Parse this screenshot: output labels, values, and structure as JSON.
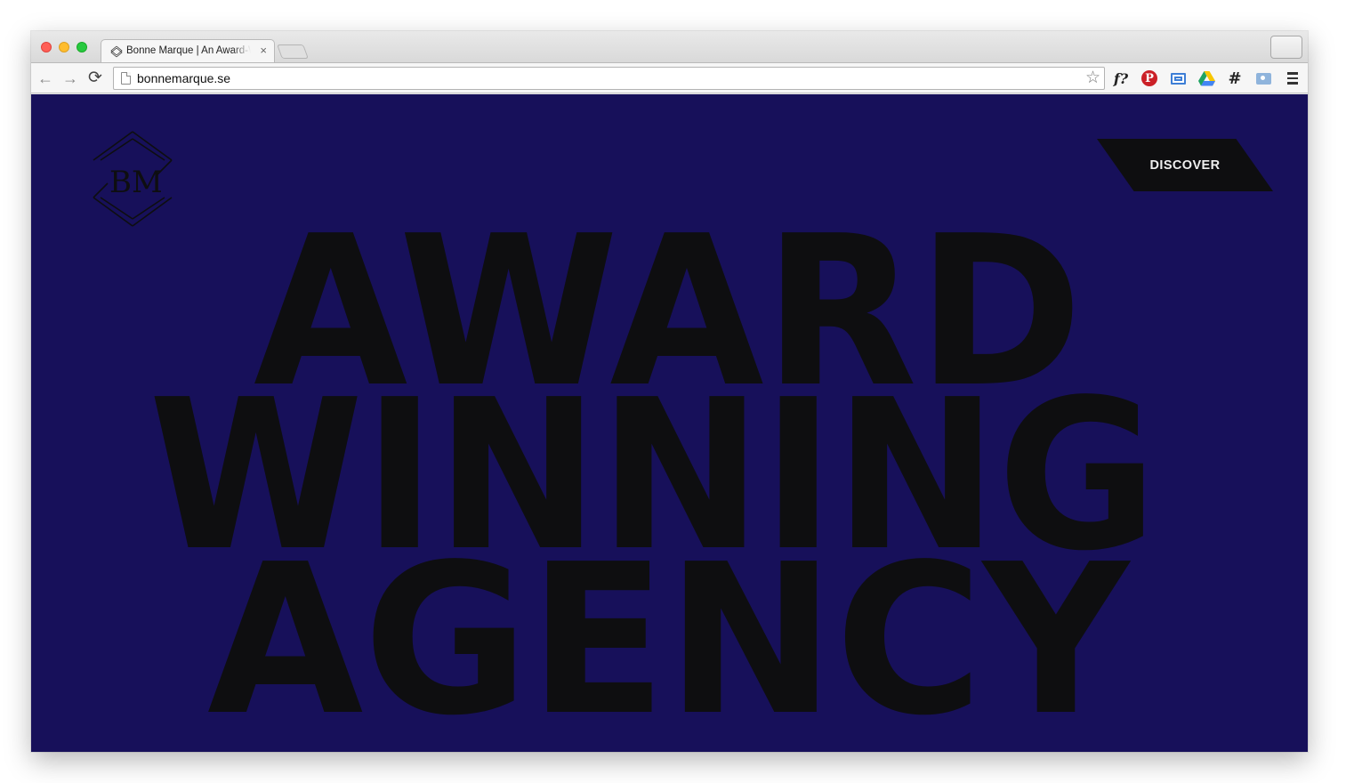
{
  "browser": {
    "tab": {
      "title": "Bonne Marque | An Award-Winning Agency",
      "close_glyph": "×"
    },
    "toolbar": {
      "back_glyph": "←",
      "forward_glyph": "→",
      "reload_glyph": "⟳",
      "url": "bonnemarque.se",
      "star_glyph": "☆",
      "extensions": [
        {
          "name": "whatfont",
          "glyph": "f?"
        },
        {
          "name": "pinterest",
          "glyph": "P"
        },
        {
          "name": "screenshot",
          "glyph": ""
        },
        {
          "name": "google-drive",
          "glyph": ""
        },
        {
          "name": "hashtag",
          "glyph": "#"
        },
        {
          "name": "camera",
          "glyph": ""
        }
      ]
    }
  },
  "page": {
    "background_color": "#17105a",
    "text_color": "#0e0e10",
    "logo": {
      "letters": "BM"
    },
    "discover_button": {
      "label": "DISCOVER"
    },
    "headline": {
      "line1": "AWARD",
      "line2": "WINNING",
      "line3": "AGENCY"
    }
  }
}
